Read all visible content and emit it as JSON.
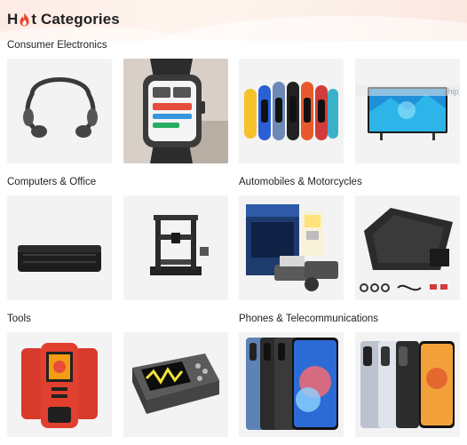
{
  "header": {
    "title_prefix": "H",
    "title_suffix": "t Categories",
    "flame_icon": "flame-icon",
    "accent_color": "#e8452c"
  },
  "sections": [
    {
      "label": "Consumer Electronics",
      "items": [
        "bone-conduction-headphones",
        "smartwatch",
        "fitness-bands",
        "smart-tv"
      ]
    },
    {
      "label": "Computers & Office",
      "items": [
        "projector",
        "3d-printer"
      ]
    },
    {
      "label": "Automobiles & Motorcycles",
      "items": [
        "led-headlight-bulbs",
        "car-seat-cover"
      ]
    },
    {
      "label": "Tools",
      "items": [
        "thermal-camera",
        "oscilloscope"
      ]
    },
    {
      "label": "Phones & Telecommunications",
      "items": [
        "smartphones-blue",
        "smartphones-silver"
      ]
    }
  ],
  "tv_overlay_text": "chip"
}
